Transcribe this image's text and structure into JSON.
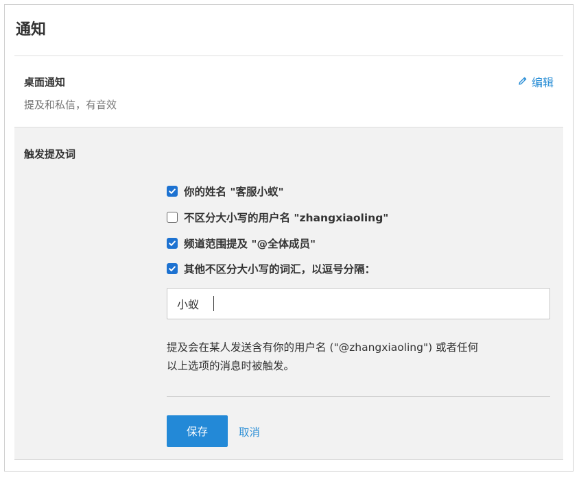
{
  "header": {
    "title": "通知"
  },
  "desktop": {
    "title": "桌面通知",
    "subtitle": "提及和私信，有音效",
    "edit_label": "编辑"
  },
  "mentions": {
    "title": "触发提及词",
    "options": [
      {
        "label": "你的姓名 \"客服小蚁\"",
        "checked": true
      },
      {
        "label": "不区分大小写的用户名 \"zhangxiaoling\"",
        "checked": false
      },
      {
        "label": "频道范围提及 \"@全体成员\"",
        "checked": true
      },
      {
        "label": "其他不区分大小写的词汇，以逗号分隔：",
        "checked": true
      }
    ],
    "keywords_value": "小蚁",
    "help_line1": "提及会在某人发送含有你的用户名 (\"@zhangxiaoling\") 或者任何",
    "help_line2": "以上选项的消息时被触发。",
    "save_label": "保存",
    "cancel_label": "取消"
  },
  "colors": {
    "accent": "#2389d7",
    "link": "#2c8fd6",
    "checkbox": "#1d72d1",
    "panel_bg": "#f2f2f2"
  },
  "icons": {
    "edit": "pencil-icon",
    "checked": "checkmark-icon"
  }
}
